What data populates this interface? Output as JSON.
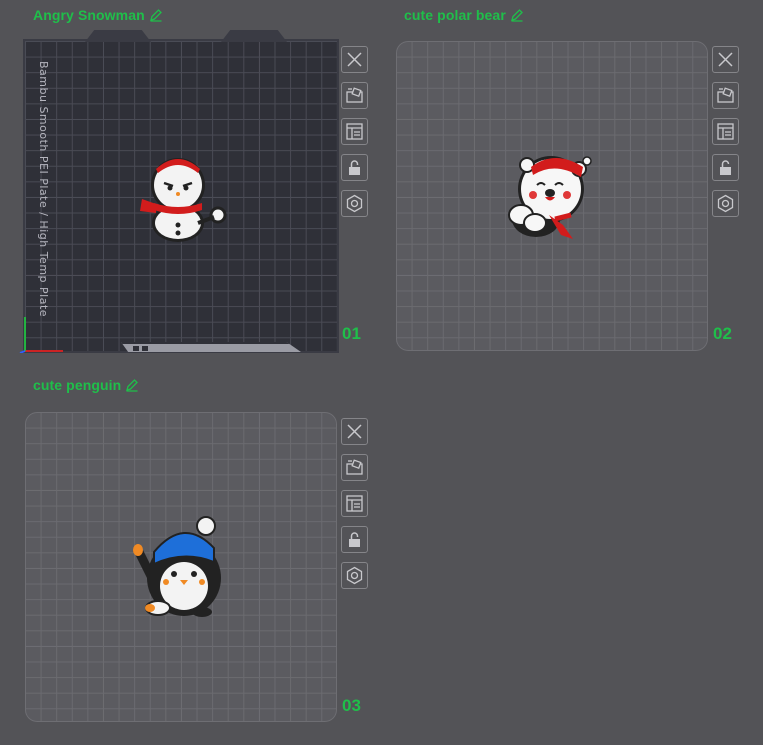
{
  "plates": [
    {
      "name": "Angry Snowman",
      "number": "01",
      "active": true,
      "bed_label": "Bambu Smooth PEI Plate / High Temp Plate"
    },
    {
      "name": "cute polar bear",
      "number": "02",
      "active": false
    },
    {
      "name": "cute penguin",
      "number": "03",
      "active": false
    }
  ],
  "toolbar_icons": [
    "close-icon",
    "arrange-icon",
    "layout-icon",
    "lock-icon",
    "settings-hex-icon"
  ],
  "colors": {
    "accent": "#1fbf4a",
    "background": "#535357",
    "active_plate": "#2f3038"
  }
}
